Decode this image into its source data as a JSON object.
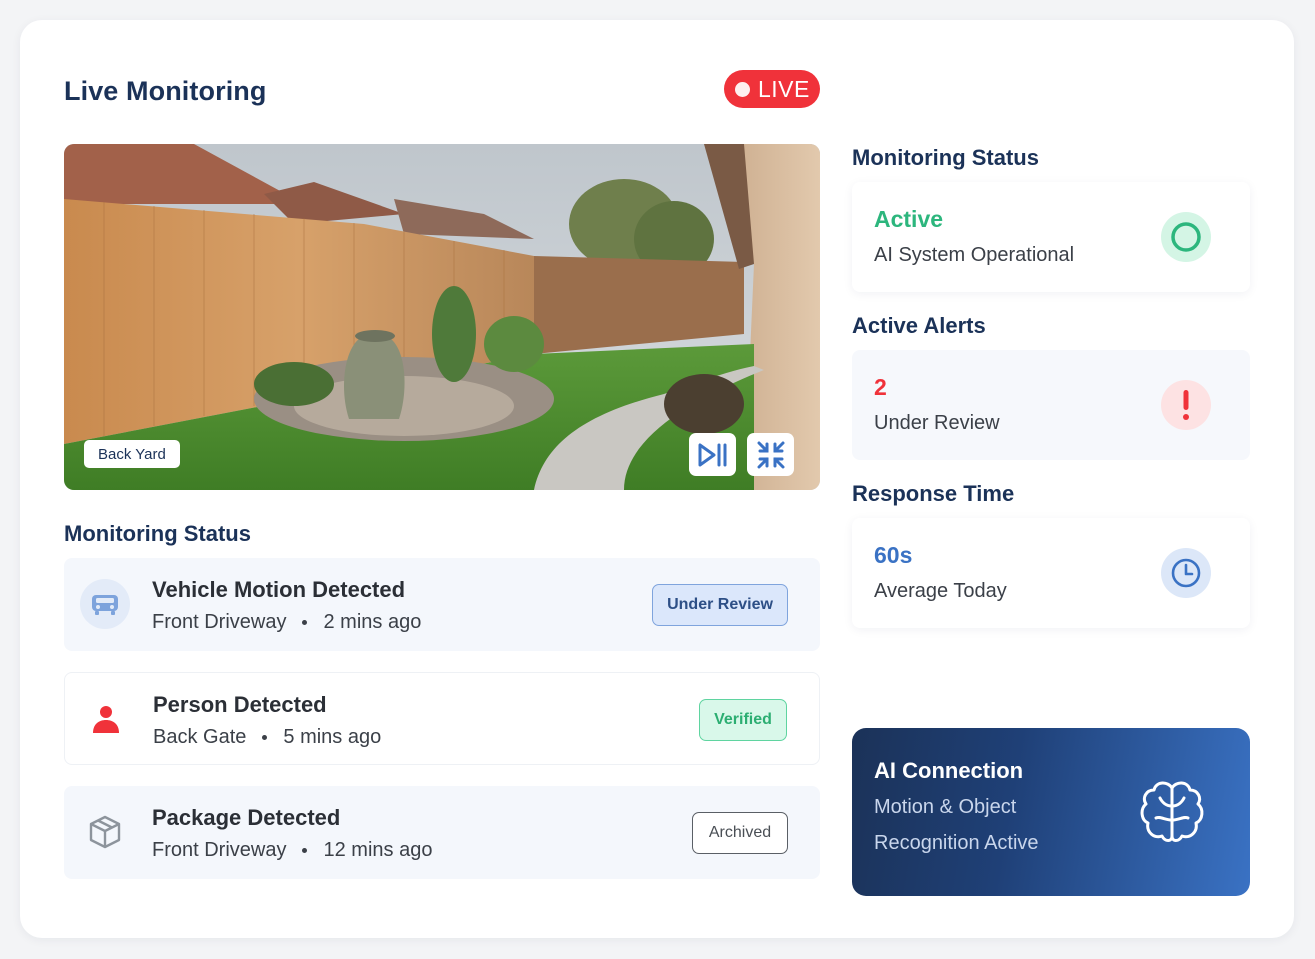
{
  "header": {
    "title": "Live Monitoring",
    "live_label": "LIVE"
  },
  "camera": {
    "location_label": "Back Yard",
    "controls": [
      "play-pause-icon",
      "minimize-icon"
    ]
  },
  "events_section": {
    "title": "Monitoring Status",
    "items": [
      {
        "title": "Vehicle Motion Detected",
        "location": "Front Driveway",
        "time": "2 mins ago",
        "status": "Under Review",
        "icon": "car-icon"
      },
      {
        "title": "Person Detected",
        "location": "Back Gate",
        "time": "5 mins ago",
        "status": "Verified",
        "icon": "person-icon"
      },
      {
        "title": "Package Detected",
        "location": "Front Driveway",
        "time": "12 mins ago",
        "status": "Archived",
        "icon": "package-icon"
      }
    ]
  },
  "sidebar": {
    "monitoring_status": {
      "heading": "Monitoring Status",
      "value": "Active",
      "label": "AI System Operational",
      "icon": "status-ring-icon",
      "color": "#2cb67d"
    },
    "active_alerts": {
      "heading": "Active Alerts",
      "value": "2",
      "label": "Under Review",
      "icon": "alert-icon",
      "color": "#f0323a"
    },
    "response_time": {
      "heading": "Response Time",
      "value": "60s",
      "label": "Average Today",
      "icon": "clock-icon",
      "color": "#3a72c4"
    }
  },
  "ai_card": {
    "title": "AI Connection",
    "line1": "Motion & Object",
    "line2": "Recognition Active",
    "icon": "brain-icon"
  },
  "colors": {
    "navy": "#1b3258",
    "live_red": "#f0323a",
    "success_green": "#2cb67d",
    "accent_blue": "#3a72c4"
  }
}
